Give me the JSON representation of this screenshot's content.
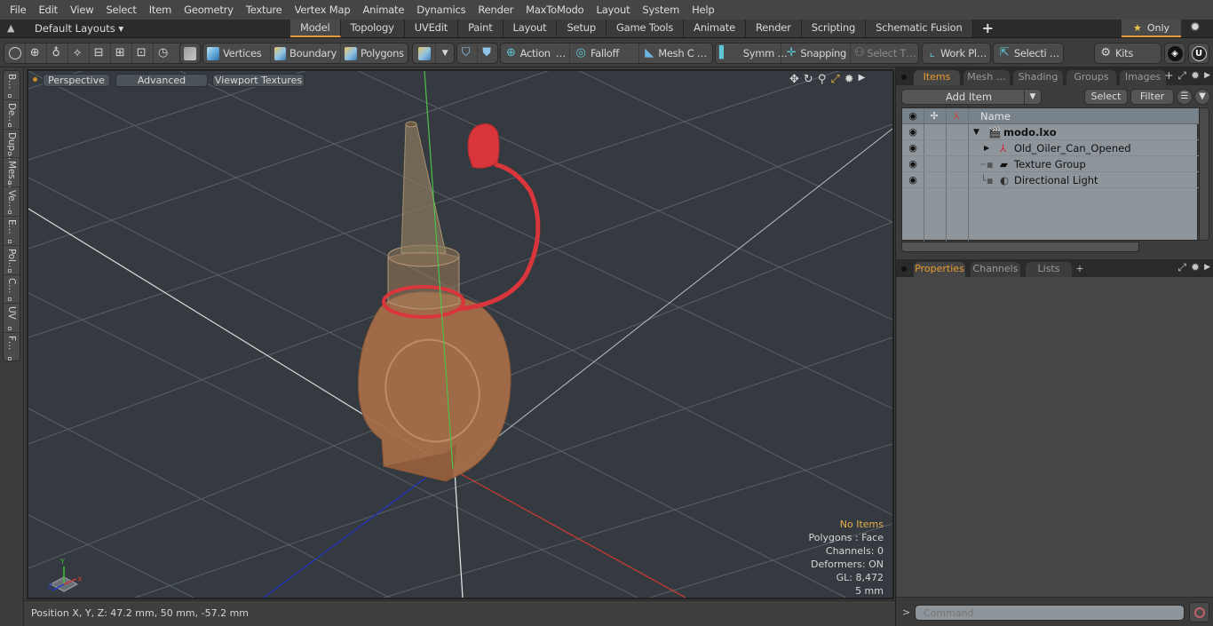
{
  "menubar": {
    "items": [
      "File",
      "Edit",
      "View",
      "Select",
      "Item",
      "Geometry",
      "Texture",
      "Vertex Map",
      "Animate",
      "Dynamics",
      "Render",
      "MaxToModo",
      "Layout",
      "System",
      "Help"
    ]
  },
  "layoutbar": {
    "layouts_label": "Default Layouts ▾",
    "tabs": [
      "Model",
      "Topology",
      "UVEdit",
      "Paint",
      "Layout",
      "Setup",
      "Game Tools",
      "Animate",
      "Render",
      "Scripting",
      "Schematic Fusion"
    ],
    "active_tab": "Model",
    "add_tab": "+",
    "only_label": "Only",
    "accent_color": "#e59a3a"
  },
  "toolbar": {
    "vertices": "Vertices",
    "boundary": "Boundary",
    "polygons": "Polygons",
    "action": "Action",
    "action_more": "…",
    "falloff": "Falloff",
    "mesh_c": "Mesh C …",
    "symm": "Symm …",
    "snapping": "Snapping",
    "select_t": "Select T…",
    "work_pl": "Work Pl…",
    "selecti": "Selecti …",
    "kits": "Kits"
  },
  "left_tabs": [
    "B…",
    "De…",
    "Dup…",
    "Mes…",
    "Ve…",
    "E…",
    "Pol…",
    "C…",
    "UV",
    "F…"
  ],
  "viewport": {
    "view_mode": "Perspective",
    "shading": "Advanced",
    "textures": "Viewport Textures",
    "info": {
      "selection": "No Items",
      "polygons": "Polygons : Face",
      "channels": "Channels: 0",
      "deformers": "Deformers: ON",
      "gl": "GL: 8,472",
      "grid": "5 mm"
    },
    "axis_labels": {
      "x": "X",
      "y": "Y",
      "z": "Z"
    }
  },
  "statusbar": {
    "position": "Position X, Y, Z:   47.2 mm, 50 mm, -57.2 mm"
  },
  "items_panel": {
    "tabs": [
      "Items",
      "Mesh …",
      "Shading",
      "Groups",
      "Images"
    ],
    "active_tab": "Items",
    "add_item": "Add Item",
    "select": "Select",
    "filter": "Filter",
    "name_header": "Name",
    "rows": [
      {
        "label": "modo.lxo",
        "bold": true,
        "icon": "scene-icon",
        "expander": "▼"
      },
      {
        "label": "Old_Oiler_Can_Opened",
        "bold": false,
        "icon": "mesh-locator-icon",
        "expander": "▶"
      },
      {
        "label": "Texture Group",
        "bold": false,
        "icon": "texture-group-icon",
        "expander": ""
      },
      {
        "label": "Directional Light",
        "bold": false,
        "icon": "light-icon",
        "expander": ""
      }
    ]
  },
  "properties_panel": {
    "tabs": [
      "Properties",
      "Channels",
      "Lists"
    ],
    "active_tab": "Properties",
    "add_tab": "+"
  },
  "command": {
    "prompt": ">",
    "placeholder": "Command"
  }
}
